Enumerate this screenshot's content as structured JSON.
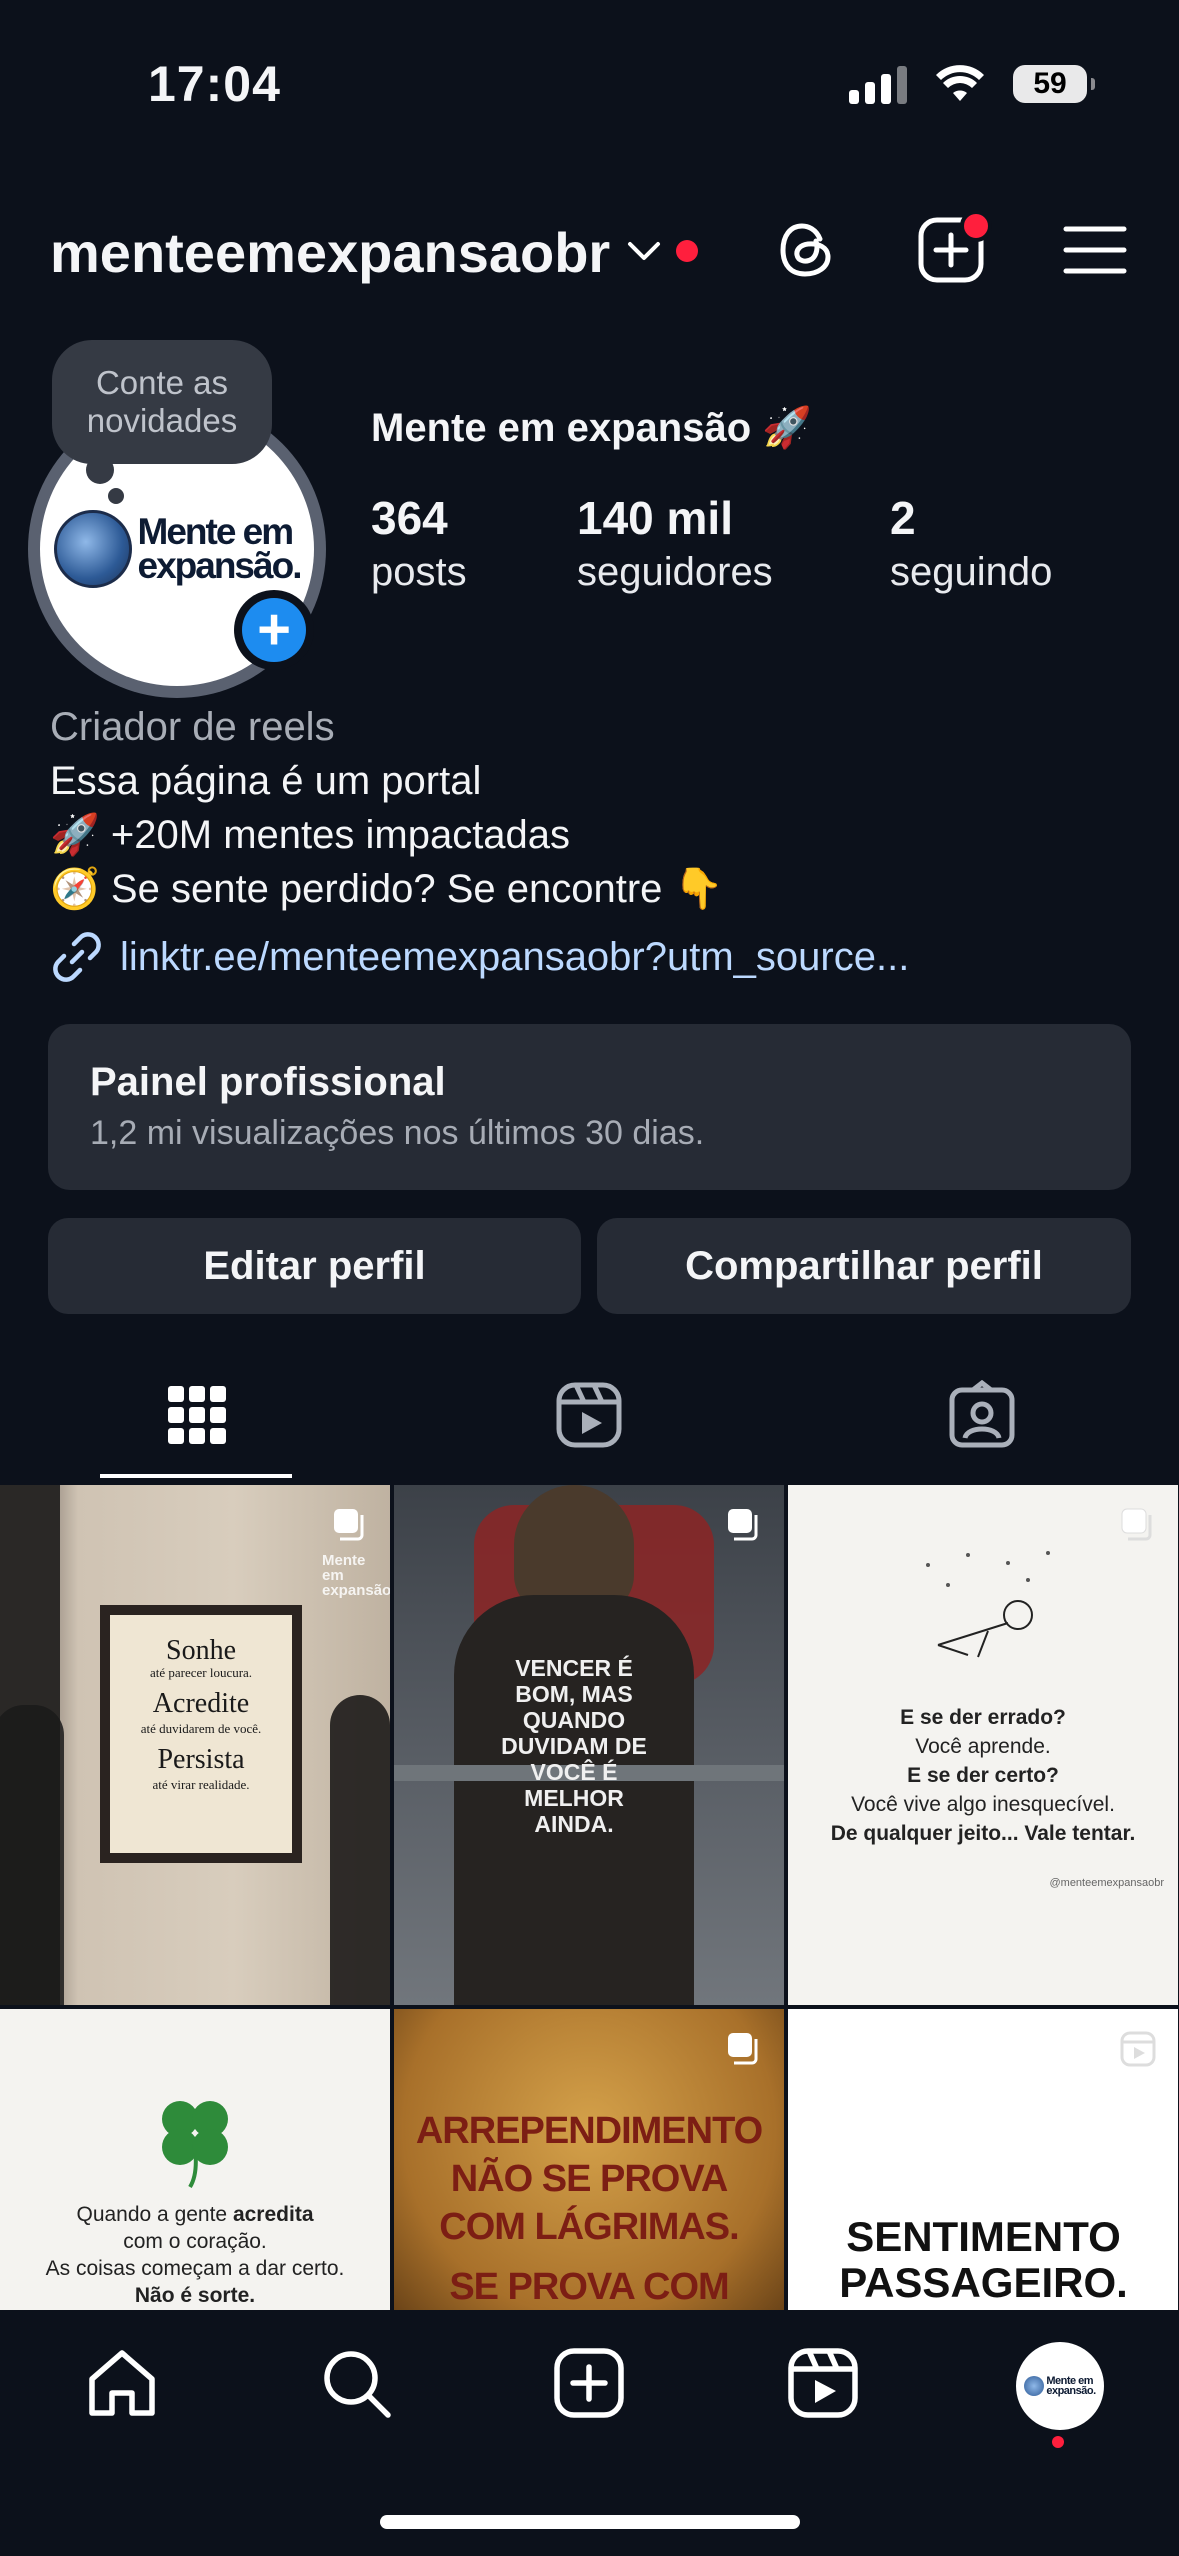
{
  "status_bar": {
    "time": "17:04",
    "battery": "59"
  },
  "header": {
    "username": "menteemexpansaobr"
  },
  "profile": {
    "note": "Conte as novidades",
    "logo_text_line1": "Mente em",
    "logo_text_line2": "expansão.",
    "display_name": "Mente em expansão 🚀",
    "stats": [
      {
        "value": "364",
        "label": "posts"
      },
      {
        "value": "140 mil",
        "label": "seguidores"
      },
      {
        "value": "2",
        "label": "seguindo"
      }
    ],
    "category": "Criador de reels",
    "bio": [
      "Essa página é um portal",
      "🚀 +20M mentes impactadas",
      "🧭 Se sente perdido? Se encontre 👇"
    ],
    "link": "linktr.ee/menteemexpansaobr?utm_source..."
  },
  "professional_panel": {
    "title": "Painel profissional",
    "subtitle": "1,2 mi visualizações nos últimos 30 dias."
  },
  "buttons": {
    "edit": "Editar perfil",
    "share": "Compartilhar perfil"
  },
  "posts": {
    "p1": {
      "line1": "Sonhe",
      "line1b": "até parecer loucura.",
      "line2": "Acredite",
      "line2b": "até duvidarem de você.",
      "line3": "Persista",
      "line3b": "até virar realidade.",
      "watermark": "Mente em expansão"
    },
    "p2": {
      "text": "VENCER É BOM, MAS QUANDO DUVIDAM DE VOCÊ É MELHOR AINDA."
    },
    "p3": {
      "l1": "E se der errado?",
      "l2": "Você aprende.",
      "l3": "E se der certo?",
      "l4": "Você vive algo inesquecível.",
      "l5": "De qualquer jeito... Vale tentar.",
      "handle": "@menteemexpansaobr"
    },
    "p4": {
      "l1a": "Quando a gente ",
      "l1b": "acredita",
      "l2": "com o coração.",
      "l3": "As coisas começam a dar certo.",
      "l4": "Não é sorte."
    },
    "p5": {
      "l1": "ARREPENDIMENTO",
      "l2": "NÃO SE PROVA",
      "l3": "COM LÁGRIMAS.",
      "l4": "SE PROVA COM"
    },
    "p6": {
      "l1": "SENTIMENTO",
      "l2": "PASSAGEIRO."
    }
  },
  "colors": {
    "background": "#0c111b",
    "accent": "#1d8cf0",
    "notification": "#ff1f3d",
    "card": "#262b35",
    "link": "#bcd9ff"
  }
}
